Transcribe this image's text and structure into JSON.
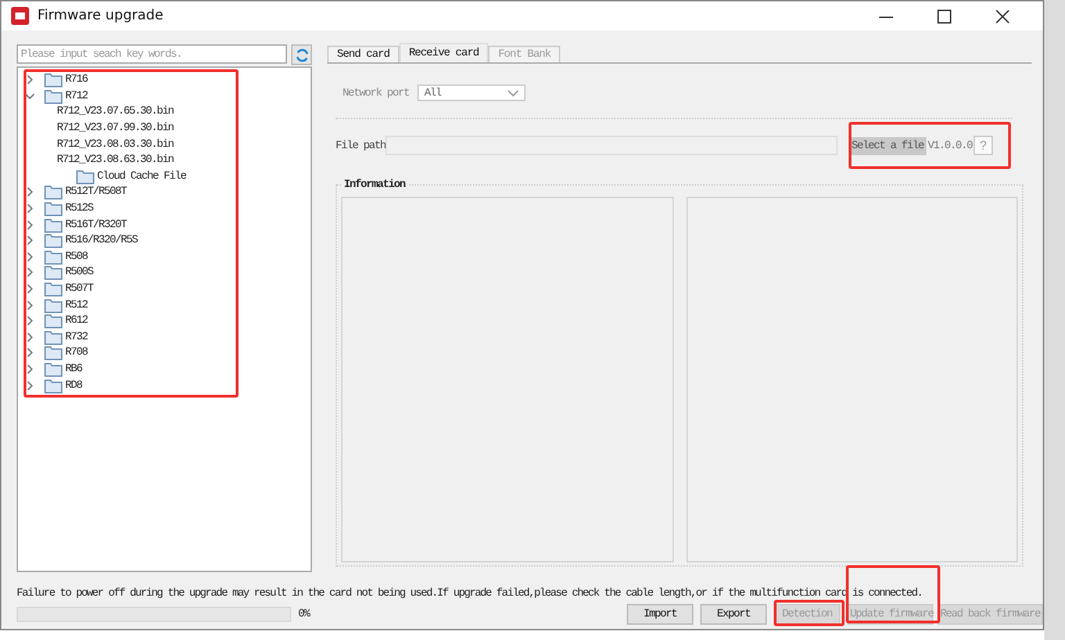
{
  "window": {
    "title": "Firmware upgrade"
  },
  "search": {
    "placeholder": "Please input seach key words."
  },
  "tree": [
    {
      "kind": "folder",
      "label": "R716",
      "expanded": false
    },
    {
      "kind": "folder",
      "label": "R712",
      "expanded": true,
      "children": [
        {
          "kind": "file",
          "label": "R712_V23.07.65.30.bin"
        },
        {
          "kind": "file",
          "label": "R712_V23.07.99.30.bin"
        },
        {
          "kind": "file",
          "label": "R712_V23.08.03.30.bin"
        },
        {
          "kind": "file",
          "label": "R712_V23.08.63.30.bin"
        },
        {
          "kind": "cache",
          "label": "Cloud Cache File"
        }
      ]
    },
    {
      "kind": "folder",
      "label": "R512T/R508T",
      "expanded": false
    },
    {
      "kind": "folder",
      "label": "R512S",
      "expanded": false
    },
    {
      "kind": "folder",
      "label": "R516T/R320T",
      "expanded": false
    },
    {
      "kind": "folder",
      "label": "R516/R320/R5S",
      "expanded": false
    },
    {
      "kind": "folder",
      "label": "R508",
      "expanded": false
    },
    {
      "kind": "folder",
      "label": "R500S",
      "expanded": false
    },
    {
      "kind": "folder",
      "label": "R507T",
      "expanded": false
    },
    {
      "kind": "folder",
      "label": "R512",
      "expanded": false
    },
    {
      "kind": "folder",
      "label": "R612",
      "expanded": false
    },
    {
      "kind": "folder",
      "label": "R732",
      "expanded": false
    },
    {
      "kind": "folder",
      "label": "R708",
      "expanded": false
    },
    {
      "kind": "folder",
      "label": "RB6",
      "expanded": false
    },
    {
      "kind": "folder",
      "label": "RD8",
      "expanded": false
    }
  ],
  "tabs": [
    {
      "label": "Send card",
      "selected": false,
      "disabled": false
    },
    {
      "label": "Receive card",
      "selected": true,
      "disabled": false
    },
    {
      "label": "Font Bank",
      "selected": false,
      "disabled": true
    }
  ],
  "network_port": {
    "label": "Network port",
    "value": "All",
    "disabled": true
  },
  "file_path": {
    "label": "File path",
    "button": "Select a file",
    "version": "V1.0.0.0",
    "help": "?"
  },
  "information": {
    "title": "Information"
  },
  "message": "Failure to power off during the upgrade may result in the card not being used.If upgrade failed,please check the cable length,or if the multifunction card is connected.",
  "progress": {
    "level": 0,
    "reading": "0%"
  },
  "buttons": [
    {
      "label": "Import",
      "disabled": false
    },
    {
      "label": "Export",
      "disabled": false
    },
    {
      "label": "Detection",
      "disabled": true
    },
    {
      "label": "Update firmware",
      "disabled": true
    },
    {
      "label": "Read back firmware",
      "disabled": true
    }
  ]
}
